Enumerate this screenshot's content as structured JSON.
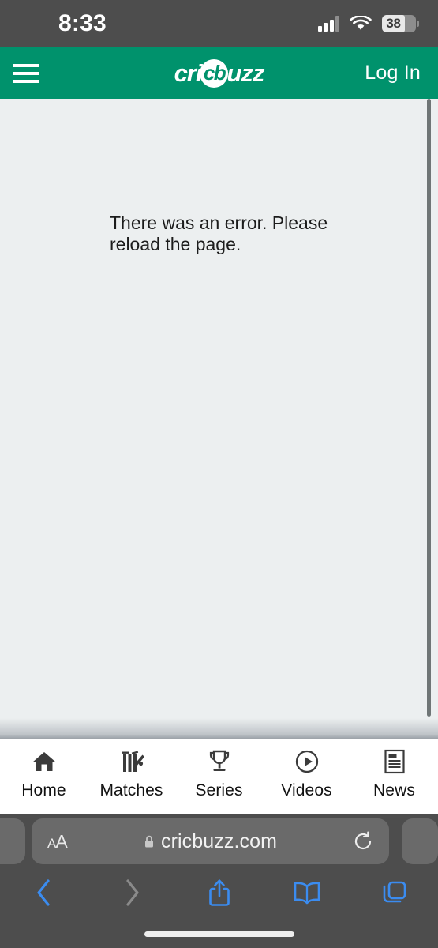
{
  "status_bar": {
    "time": "8:33",
    "battery_level": "38",
    "signal_icon": "cellular-signal-icon",
    "wifi_icon": "wifi-icon",
    "battery_icon": "battery-icon"
  },
  "site_header": {
    "menu_icon": "hamburger-menu-icon",
    "brand_part1": "cri",
    "brand_badge": "cb",
    "brand_part2": "uzz",
    "brand_full": "cricbuzz",
    "login_label": "Log In",
    "background_color": "#00926c"
  },
  "content": {
    "error_message": "There was an error. Please reload the page.",
    "background_color": "#eceff0"
  },
  "app_tabbar": {
    "tabs": [
      {
        "label": "Home",
        "icon": "home-icon"
      },
      {
        "label": "Matches",
        "icon": "cricket-wicket-icon"
      },
      {
        "label": "Series",
        "icon": "trophy-icon"
      },
      {
        "label": "Videos",
        "icon": "play-circle-icon"
      },
      {
        "label": "News",
        "icon": "news-article-icon"
      }
    ]
  },
  "browser": {
    "text_size_label": "AA",
    "lock_icon": "lock-icon",
    "url": "cricbuzz.com",
    "reload_icon": "reload-icon",
    "toolbar": [
      {
        "name": "back-button",
        "icon": "chevron-left-icon",
        "enabled": "true"
      },
      {
        "name": "forward-button",
        "icon": "chevron-right-icon",
        "enabled": "false"
      },
      {
        "name": "share-button",
        "icon": "share-icon",
        "enabled": "true"
      },
      {
        "name": "bookmarks-button",
        "icon": "book-icon",
        "enabled": "true"
      },
      {
        "name": "tabs-button",
        "icon": "tabs-icon",
        "enabled": "true"
      }
    ],
    "accent_color": "#3b8cf0",
    "disabled_color": "#8a8a8a"
  }
}
